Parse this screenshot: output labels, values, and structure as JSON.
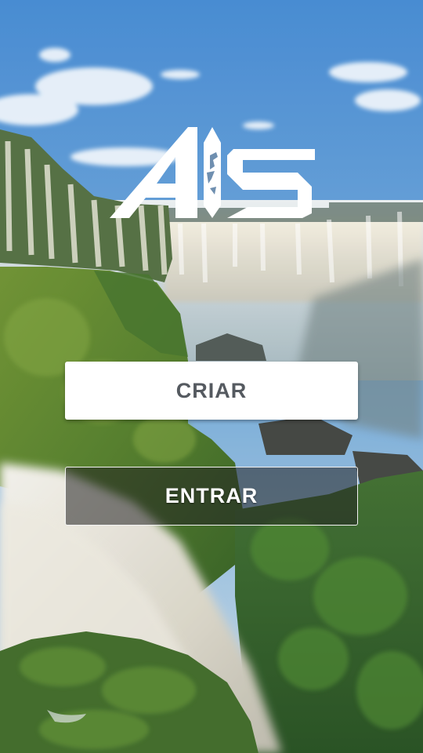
{
  "app": {
    "logo_text": "AIS",
    "background": "waterfall-landscape"
  },
  "buttons": {
    "criar_label": "CRIAR",
    "entrar_label": "ENTRAR"
  },
  "colors": {
    "primary_button_bg": "#ffffff",
    "primary_button_text": "#555a60",
    "secondary_button_bg": "rgba(35,35,35,0.55)",
    "secondary_button_text": "#ffffff",
    "secondary_button_border": "#f2f2f2"
  }
}
